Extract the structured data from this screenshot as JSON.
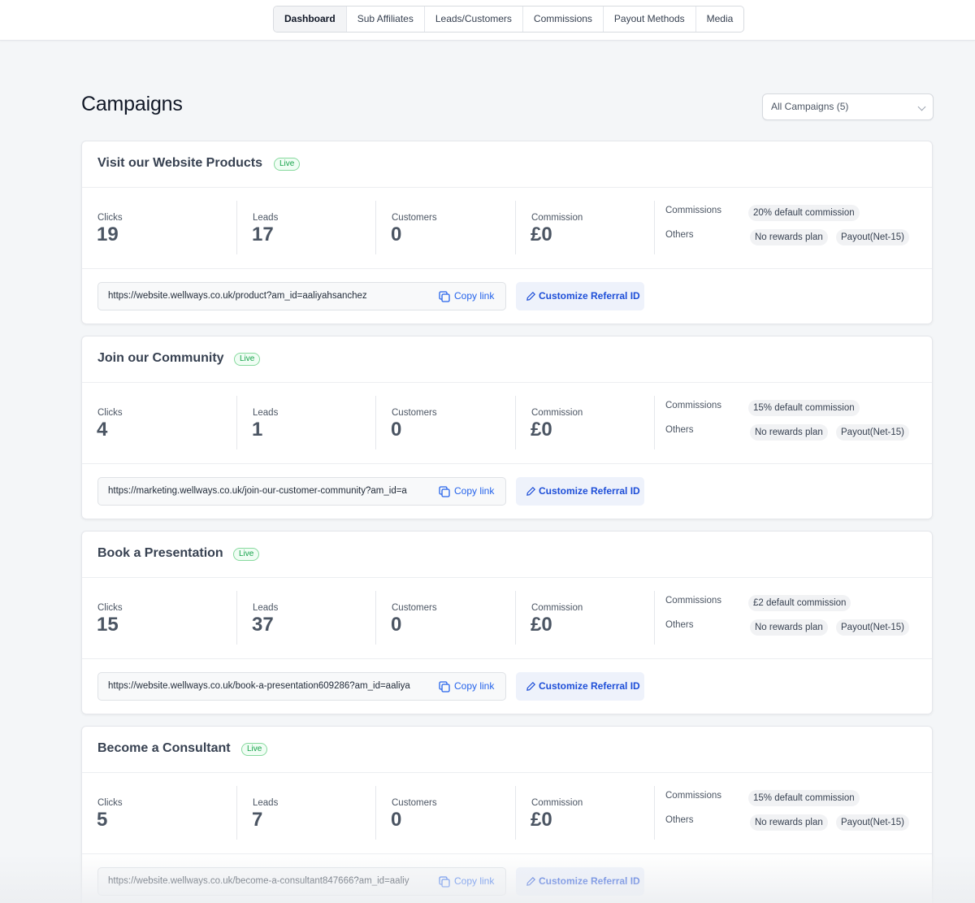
{
  "nav": {
    "tabs": [
      {
        "label": "Dashboard",
        "active": true
      },
      {
        "label": "Sub Affiliates",
        "active": false
      },
      {
        "label": "Leads/Customers",
        "active": false
      },
      {
        "label": "Commissions",
        "active": false
      },
      {
        "label": "Payout Methods",
        "active": false
      },
      {
        "label": "Media",
        "active": false
      }
    ]
  },
  "page": {
    "title": "Campaigns",
    "filter_value": "All Campaigns (5)"
  },
  "labels": {
    "clicks": "Clicks",
    "leads": "Leads",
    "customers": "Customers",
    "commission": "Commission",
    "commissions": "Commissions",
    "others": "Others",
    "copy_link": "Copy link",
    "customize": "Customize Referral ID",
    "live": "Live"
  },
  "colors": {
    "accent": "#2563eb",
    "live_green": "#16a34a"
  },
  "campaigns": [
    {
      "title": "Visit our Website Products",
      "status": "Live",
      "clicks": "19",
      "leads": "17",
      "customers": "0",
      "commission": "£0",
      "commission_plan": "20% default commission",
      "others": [
        "No rewards plan",
        "Payout(Net-15)"
      ],
      "url": "https://website.wellways.co.uk/product?am_id=aaliyahsanchez"
    },
    {
      "title": "Join our Community",
      "status": "Live",
      "clicks": "4",
      "leads": "1",
      "customers": "0",
      "commission": "£0",
      "commission_plan": "15% default commission",
      "others": [
        "No rewards plan",
        "Payout(Net-15)"
      ],
      "url": "https://marketing.wellways.co.uk/join-our-customer-community?am_id=a"
    },
    {
      "title": "Book a Presentation",
      "status": "Live",
      "clicks": "15",
      "leads": "37",
      "customers": "0",
      "commission": "£0",
      "commission_plan": "£2 default commission",
      "others": [
        "No rewards plan",
        "Payout(Net-15)"
      ],
      "url": "https://website.wellways.co.uk/book-a-presentation609286?am_id=aaliya"
    },
    {
      "title": "Become a Consultant",
      "status": "Live",
      "clicks": "5",
      "leads": "7",
      "customers": "0",
      "commission": "£0",
      "commission_plan": "15% default commission",
      "others": [
        "No rewards plan",
        "Payout(Net-15)"
      ],
      "url": "https://website.wellways.co.uk/become-a-consultant847666?am_id=aaliy"
    }
  ]
}
